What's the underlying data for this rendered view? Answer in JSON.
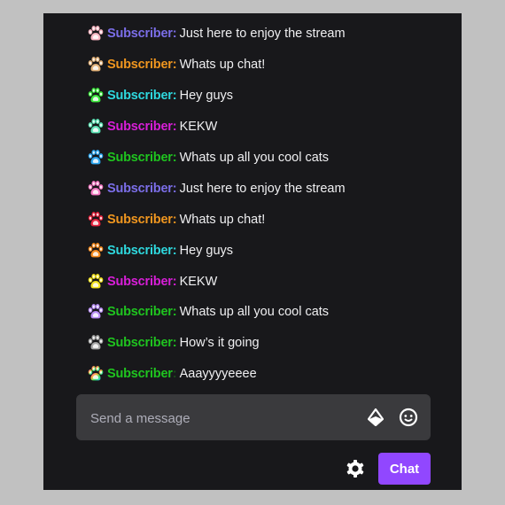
{
  "chat": {
    "messages": [
      {
        "username": "Subscriber",
        "separator": ":",
        "text": "Just here to enjoy the stream",
        "name_color": "#7b6ee8",
        "badge": "paw-badge-light-pink",
        "badge_color": "#f7b6c2"
      },
      {
        "username": "Subscriber",
        "separator": ":",
        "text": "Whats up chat!",
        "name_color": "#f0961f",
        "badge": "paw-badge-tan",
        "badge_color": "#e2b27a"
      },
      {
        "username": "Subscriber",
        "separator": ":",
        "text": "Hey guys",
        "name_color": "#2ed8de",
        "badge": "paw-badge-green",
        "badge_color": "#3ee83e"
      },
      {
        "username": "Subscriber",
        "separator": ":",
        "text": "KEKW",
        "name_color": "#d81ed8",
        "badge": "paw-badge-mint",
        "badge_color": "#5fe3b6"
      },
      {
        "username": "Subscriber",
        "separator": ":",
        "text": "Whats up all you cool cats",
        "name_color": "#1fc41f",
        "badge": "paw-badge-blue",
        "badge_color": "#2ea7f0"
      },
      {
        "username": "Subscriber",
        "separator": ":",
        "text": "Just here to enjoy the stream",
        "name_color": "#7b6ee8",
        "badge": "paw-badge-pink",
        "badge_color": "#f57bc4"
      },
      {
        "username": "Subscriber",
        "separator": ":",
        "text": "Whats up chat!",
        "name_color": "#f0961f",
        "badge": "paw-badge-red",
        "badge_color": "#e8243f"
      },
      {
        "username": "Subscriber",
        "separator": ":",
        "text": "Hey guys",
        "name_color": "#2ed8de",
        "badge": "paw-badge-orange",
        "badge_color": "#f58a1f"
      },
      {
        "username": "Subscriber",
        "separator": ":",
        "text": "KEKW",
        "name_color": "#d81ed8",
        "badge": "paw-badge-yellow",
        "badge_color": "#f5e51f"
      },
      {
        "username": "Subscriber",
        "separator": ":",
        "text": "Whats up all you cool cats",
        "name_color": "#1fc41f",
        "badge": "paw-badge-lavender",
        "badge_color": "#b98ef5"
      },
      {
        "username": "Subscriber",
        "separator": ":",
        "text": "How’s it going",
        "name_color": "#1fc41f",
        "badge": "paw-badge-gray",
        "badge_color": "#a6a6a6"
      },
      {
        "username": "Subscriber",
        "separator": ":",
        "text": "Aaayyyyeeee",
        "name_color": "#1fc41f",
        "separator_color": "#1a4a1a",
        "badge": "paw-badge-rainbow",
        "badge_color": "rainbow"
      }
    ],
    "text_color": "#efeff1"
  },
  "composer": {
    "placeholder": "Send a message",
    "value": "",
    "bits_icon": "bits-icon",
    "emote_icon": "emote-picker-icon"
  },
  "footer": {
    "settings_icon": "gear-icon",
    "chat_button_label": "Chat",
    "accent_color": "#9147ff"
  }
}
